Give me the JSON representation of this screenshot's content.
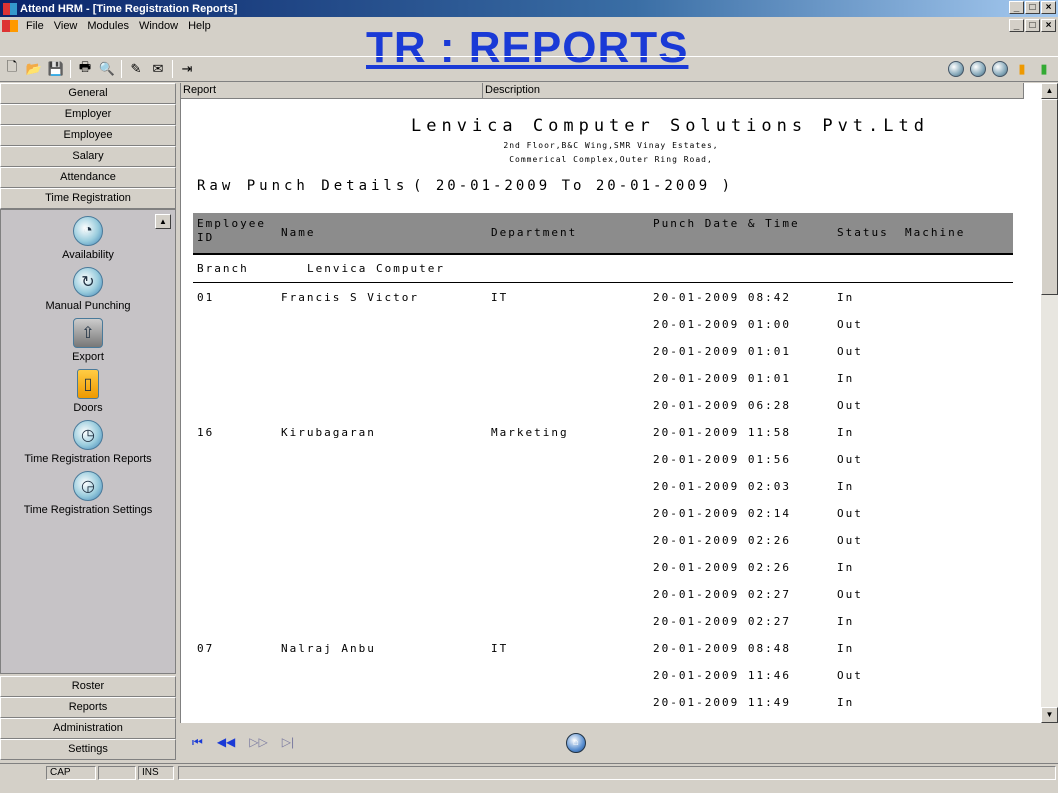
{
  "window": {
    "title": "Attend HRM - [Time Registration Reports]"
  },
  "menu": {
    "items": [
      "File",
      "View",
      "Modules",
      "Window",
      "Help"
    ]
  },
  "overlay_title": "TR : REPORTS",
  "sidebar": {
    "top_buttons": [
      "General",
      "Employer",
      "Employee",
      "Salary",
      "Attendance",
      "Time Registration"
    ],
    "panel_items": [
      "Availability",
      "Manual Punching",
      "Export",
      "Doors",
      "Time Registration Reports",
      "Time Registration Settings"
    ],
    "bottom_buttons": [
      "Roster",
      "Reports",
      "Administration",
      "Settings"
    ]
  },
  "grid": {
    "col_report": "Report",
    "col_description": "Description"
  },
  "report": {
    "company": "Lenvica Computer Solutions Pvt.Ltd",
    "address1": "2nd Floor,B&C Wing,SMR Vinay Estates,",
    "address2": "Commerical Complex,Outer Ring Road,",
    "title": "Raw Punch Details",
    "range": "( 20-01-2009 To 20-01-2009 )",
    "headers": {
      "employee_id": "Employee ID",
      "name": "Name",
      "department": "Department",
      "punch": "Punch Date & Time",
      "status": "Status",
      "machine": "Machine"
    },
    "branch_label": "Branch",
    "branch_value": "Lenvica Computer",
    "rows": [
      {
        "id": "01",
        "name": "Francis S Victor",
        "dept": "IT",
        "punch": "20-01-2009 08:42",
        "status": "In"
      },
      {
        "id": "",
        "name": "",
        "dept": "",
        "punch": "20-01-2009 01:00",
        "status": "Out"
      },
      {
        "id": "",
        "name": "",
        "dept": "",
        "punch": "20-01-2009 01:01",
        "status": "Out"
      },
      {
        "id": "",
        "name": "",
        "dept": "",
        "punch": "20-01-2009 01:01",
        "status": "In"
      },
      {
        "id": "",
        "name": "",
        "dept": "",
        "punch": "20-01-2009 06:28",
        "status": "Out"
      },
      {
        "id": "16",
        "name": "Kirubagaran",
        "dept": "Marketing",
        "punch": "20-01-2009 11:58",
        "status": "In"
      },
      {
        "id": "",
        "name": "",
        "dept": "",
        "punch": "20-01-2009 01:56",
        "status": "Out"
      },
      {
        "id": "",
        "name": "",
        "dept": "",
        "punch": "20-01-2009 02:03",
        "status": "In"
      },
      {
        "id": "",
        "name": "",
        "dept": "",
        "punch": "20-01-2009 02:14",
        "status": "Out"
      },
      {
        "id": "",
        "name": "",
        "dept": "",
        "punch": "20-01-2009 02:26",
        "status": "Out"
      },
      {
        "id": "",
        "name": "",
        "dept": "",
        "punch": "20-01-2009 02:26",
        "status": "In"
      },
      {
        "id": "",
        "name": "",
        "dept": "",
        "punch": "20-01-2009 02:27",
        "status": "Out"
      },
      {
        "id": "",
        "name": "",
        "dept": "",
        "punch": "20-01-2009 02:27",
        "status": "In"
      },
      {
        "id": "07",
        "name": "Nalraj Anbu",
        "dept": "IT",
        "punch": "20-01-2009 08:48",
        "status": "In"
      },
      {
        "id": "",
        "name": "",
        "dept": "",
        "punch": "20-01-2009 11:46",
        "status": "Out"
      },
      {
        "id": "",
        "name": "",
        "dept": "",
        "punch": "20-01-2009 11:49",
        "status": "In"
      }
    ]
  },
  "statusbar": {
    "cap": "CAP",
    "ins": "INS"
  },
  "colors": {
    "overlay_title": "#1a3ad6",
    "table_header": "#8c8c8c",
    "title_bar": "#0a246a"
  }
}
